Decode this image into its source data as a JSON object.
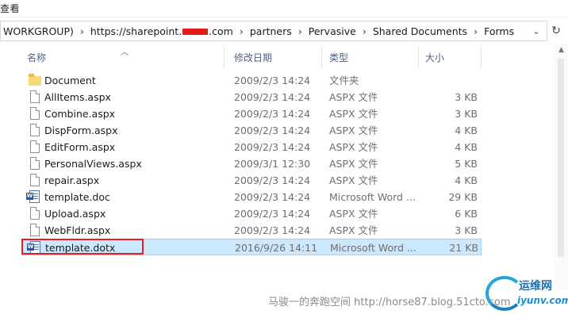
{
  "ribbon": {
    "tab_label": "查看"
  },
  "address": {
    "crumbs": [
      "WORKGROUP)",
      "https://sharepoint.",
      ".com",
      "partners",
      "Pervasive",
      "Shared Documents",
      "Forms"
    ],
    "dropdown_icon": "chevron-down-icon",
    "refresh_icon": "refresh-icon"
  },
  "columns": {
    "name": "名称",
    "date": "修改日期",
    "type": "类型",
    "size": "大小"
  },
  "files": [
    {
      "name": "Document",
      "date": "2009/2/3 14:24",
      "type": "文件夹",
      "size": "",
      "icon": "folder"
    },
    {
      "name": "AllItems.aspx",
      "date": "2009/2/3 14:24",
      "type": "ASPX 文件",
      "size": "3 KB",
      "icon": "doc"
    },
    {
      "name": "Combine.aspx",
      "date": "2009/2/3 14:24",
      "type": "ASPX 文件",
      "size": "3 KB",
      "icon": "doc"
    },
    {
      "name": "DispForm.aspx",
      "date": "2009/2/3 14:24",
      "type": "ASPX 文件",
      "size": "4 KB",
      "icon": "doc"
    },
    {
      "name": "EditForm.aspx",
      "date": "2009/2/3 14:24",
      "type": "ASPX 文件",
      "size": "4 KB",
      "icon": "doc"
    },
    {
      "name": "PersonalViews.aspx",
      "date": "2009/3/1 12:30",
      "type": "ASPX 文件",
      "size": "5 KB",
      "icon": "doc"
    },
    {
      "name": "repair.aspx",
      "date": "2009/2/3 14:24",
      "type": "ASPX 文件",
      "size": "4 KB",
      "icon": "doc"
    },
    {
      "name": "template.doc",
      "date": "2009/2/3 14:24",
      "type": "Microsoft Word ...",
      "size": "29 KB",
      "icon": "word"
    },
    {
      "name": "Upload.aspx",
      "date": "2009/2/3 14:24",
      "type": "ASPX 文件",
      "size": "6 KB",
      "icon": "doc"
    },
    {
      "name": "WebFldr.aspx",
      "date": "2009/2/3 14:24",
      "type": "ASPX 文件",
      "size": "3 KB",
      "icon": "doc"
    },
    {
      "name": "template.dotx",
      "date": "2016/9/26 14:11",
      "type": "Microsoft Word ...",
      "size": "21 KB",
      "icon": "word",
      "selected": true
    }
  ],
  "watermark": {
    "text": "马骏一的奔跑空间 http://horse87.blog.51cto.com",
    "logo_cn": "运维网",
    "logo_url": "iyunv.com"
  },
  "colors": {
    "selection": "#cce8ff",
    "annotation": "#e81c24",
    "header_text": "#4d6182"
  }
}
